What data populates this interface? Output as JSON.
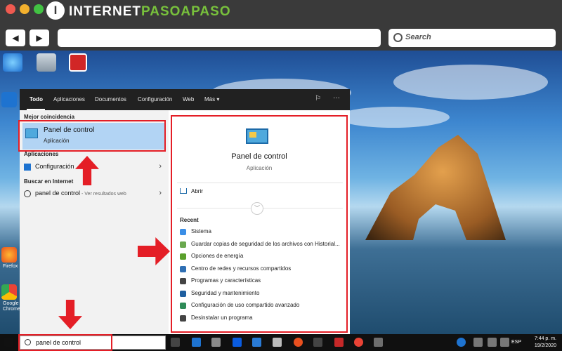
{
  "site": {
    "brand_part1": "INTERNET",
    "brand_part2": "PASOAPASO",
    "logo_letter": "I"
  },
  "browser": {
    "back_icon": "◀",
    "forward_icon": "▶",
    "url_value": "",
    "search_label": "Search"
  },
  "start_menu": {
    "tabs": {
      "todo": "Todo",
      "aplicaciones": "Aplicaciones",
      "documentos": "Documentos",
      "configuracion": "Configuración",
      "web": "Web",
      "mas": "Más ▾"
    },
    "left": {
      "best_match_heading": "Mejor coincidencia",
      "best_match_title": "Panel de control",
      "best_match_sub": "Aplicación",
      "apps_heading": "Aplicaciones",
      "app_item": "Configuración",
      "web_heading": "Buscar en Internet",
      "web_query": "panel de control",
      "web_hint": " - Ver resultados web"
    },
    "right": {
      "title": "Panel de control",
      "subtitle": "Aplicación",
      "open_label": "Abrir",
      "recent_heading": "Recent",
      "recent": [
        {
          "label": "Sistema",
          "color": "#3a8ee6"
        },
        {
          "label": "Guardar copias de seguridad de los archivos con Historial...",
          "color": "#6aa84f"
        },
        {
          "label": "Opciones de energía",
          "color": "#5aa02c"
        },
        {
          "label": "Centro de redes y recursos compartidos",
          "color": "#2f6fb3"
        },
        {
          "label": "Programas y características",
          "color": "#444444"
        },
        {
          "label": "Seguridad y mantenimiento",
          "color": "#1f5fa0"
        },
        {
          "label": "Configuración de uso compartido avanzado",
          "color": "#2e8b57"
        },
        {
          "label": "Desinstalar un programa",
          "color": "#444444"
        }
      ]
    }
  },
  "desktop": {
    "app_label_1": "Firefox",
    "app_label_2": "Google Chrome"
  },
  "taskbar": {
    "search_text": "panel de control",
    "tray_lang": "ESP",
    "tray_time": "7:44 p. m.",
    "tray_date": "19/2/2020"
  },
  "colors": {
    "highlight_red": "#e41e26",
    "selection_blue": "#b2d4f4"
  }
}
